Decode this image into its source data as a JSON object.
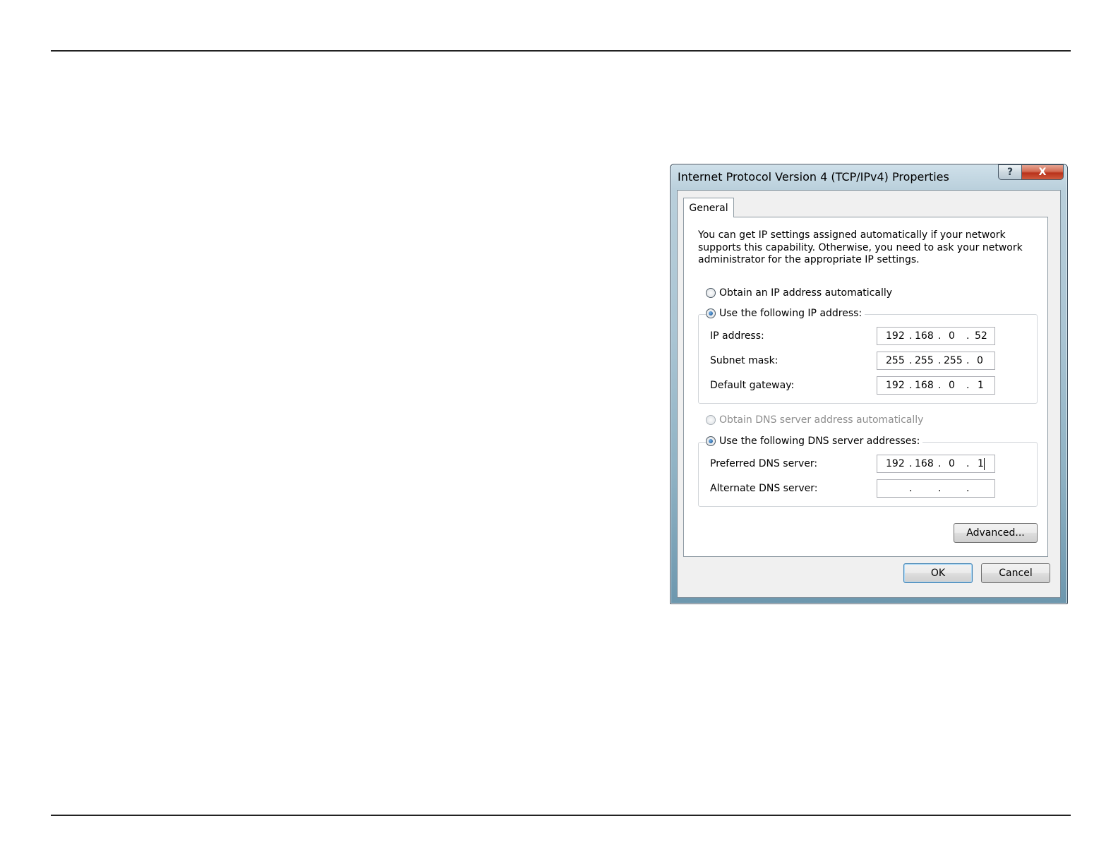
{
  "dialog": {
    "title": "Internet Protocol Version 4 (TCP/IPv4) Properties",
    "help_symbol": "?",
    "close_symbol": "X",
    "tab_label": "General",
    "intro_text": "You can get IP settings assigned automatically if your network supports this capability. Otherwise, you need to ask your network administrator for the appropriate IP settings.",
    "ip_section": {
      "auto_option": "Obtain an IP address automatically",
      "auto_selected": false,
      "manual_option": "Use the following IP address:",
      "manual_selected": true,
      "fields": [
        {
          "label": "IP address:",
          "octets": [
            "192",
            "168",
            "0",
            "52"
          ]
        },
        {
          "label": "Subnet mask:",
          "octets": [
            "255",
            "255",
            "255",
            "0"
          ]
        },
        {
          "label": "Default gateway:",
          "octets": [
            "192",
            "168",
            "0",
            "1"
          ]
        }
      ]
    },
    "dns_section": {
      "auto_option": "Obtain DNS server address automatically",
      "auto_selected": false,
      "auto_disabled": true,
      "manual_option": "Use the following DNS server addresses:",
      "manual_selected": true,
      "fields": [
        {
          "label": "Preferred DNS server:",
          "octets": [
            "192",
            "168",
            "0",
            "1"
          ]
        },
        {
          "label": "Alternate DNS server:",
          "octets": [
            "",
            "",
            "",
            ""
          ]
        }
      ]
    },
    "advanced_button": "Advanced...",
    "ok_button": "OK",
    "cancel_button": "Cancel"
  }
}
